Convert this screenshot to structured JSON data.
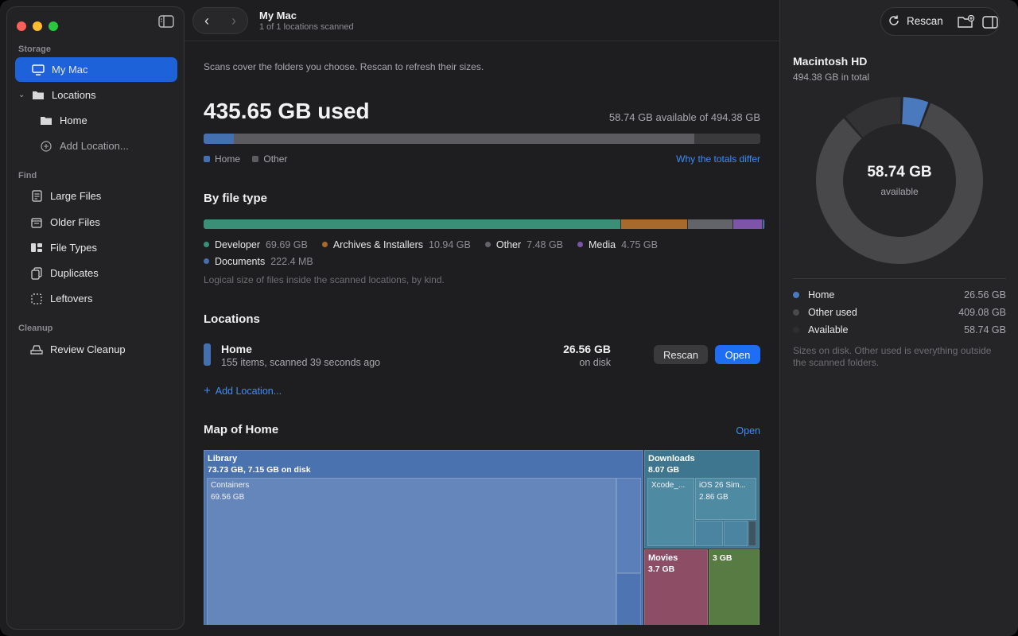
{
  "sidebar": {
    "sections": {
      "storage": "Storage",
      "find": "Find",
      "cleanup": "Cleanup"
    },
    "items": [
      {
        "label": "My Mac",
        "icon": "display-icon"
      },
      {
        "label": "Locations",
        "icon": "folder-icon"
      },
      {
        "label": "Home",
        "icon": "folder-icon"
      },
      {
        "label": "Add Location...",
        "icon": "plus-circle-icon"
      },
      {
        "label": "Large Files",
        "icon": "doc-icon"
      },
      {
        "label": "Older Files",
        "icon": "calendar-icon"
      },
      {
        "label": "File Types",
        "icon": "grid-icon"
      },
      {
        "label": "Duplicates",
        "icon": "duplicate-icon"
      },
      {
        "label": "Leftovers",
        "icon": "dashed-square-icon"
      },
      {
        "label": "Review Cleanup",
        "icon": "cleanup-icon"
      }
    ]
  },
  "header": {
    "title": "My Mac",
    "subtitle": "1 of 1 locations scanned"
  },
  "main": {
    "intro": "Scans cover the folders you choose. Rescan to refresh their sizes.",
    "used": "435.65 GB used",
    "available": "58.74 GB available of 494.38 GB",
    "usage_bar": {
      "home_fraction": 0.054,
      "other_fraction": 0.827
    },
    "legend": {
      "home": "Home",
      "other": "Other"
    },
    "why_link": "Why the totals differ",
    "by_type": {
      "title": "By file type",
      "items": [
        {
          "name": "Developer",
          "size": "69.69 GB",
          "fraction": 0.75,
          "color": "#3a8f77"
        },
        {
          "name": "Archives & Installers",
          "size": "10.94 GB",
          "fraction": 0.118,
          "color": "#a76a2c"
        },
        {
          "name": "Other",
          "size": "7.48 GB",
          "fraction": 0.081,
          "color": "#636469"
        },
        {
          "name": "Media",
          "size": "4.75 GB",
          "fraction": 0.051,
          "color": "#7d55a8"
        },
        {
          "name": "Documents",
          "size": "222.4 MB",
          "fraction": 0.003,
          "color": "#4470b0"
        }
      ],
      "note": "Logical size of files inside the scanned locations, by kind."
    },
    "locations": {
      "title": "Locations",
      "row": {
        "name": "Home",
        "detail": "155 items, scanned 39 seconds ago",
        "size": "26.56 GB",
        "size_sub": "on disk",
        "rescan": "Rescan",
        "open": "Open"
      },
      "add": "Add Location..."
    },
    "map": {
      "title": "Map of Home",
      "open": "Open",
      "library": {
        "name": "Library",
        "detail": "73.73 GB, 7.15 GB on disk"
      },
      "containers": {
        "name": "Containers",
        "size": "69.56 GB"
      },
      "downloads": {
        "name": "Downloads",
        "size": "8.07 GB"
      },
      "xcode": {
        "name": "Xcode_..."
      },
      "ios": {
        "name": "iOS 26 Sim...",
        "size": "2.86 GB"
      },
      "movies": {
        "name": "Movies",
        "size": "3.7 GB"
      },
      "green": {
        "name": "3 GB"
      }
    }
  },
  "right": {
    "rescan": "Rescan",
    "disk_name": "Macintosh HD",
    "disk_total": "494.38 GB in total",
    "center_value": "58.74 GB",
    "center_label": "available",
    "donut": {
      "home": 26.56,
      "other": 409.08,
      "available": 58.74
    },
    "rows": [
      {
        "label": "Home",
        "value": "26.56 GB",
        "color": "#4a79bd"
      },
      {
        "label": "Other used",
        "value": "409.08 GB",
        "color": "#4a4a4d"
      },
      {
        "label": "Available",
        "value": "58.74 GB",
        "color": "#2e2e31"
      }
    ],
    "note": "Sizes on disk. Other used is everything outside the scanned folders."
  }
}
